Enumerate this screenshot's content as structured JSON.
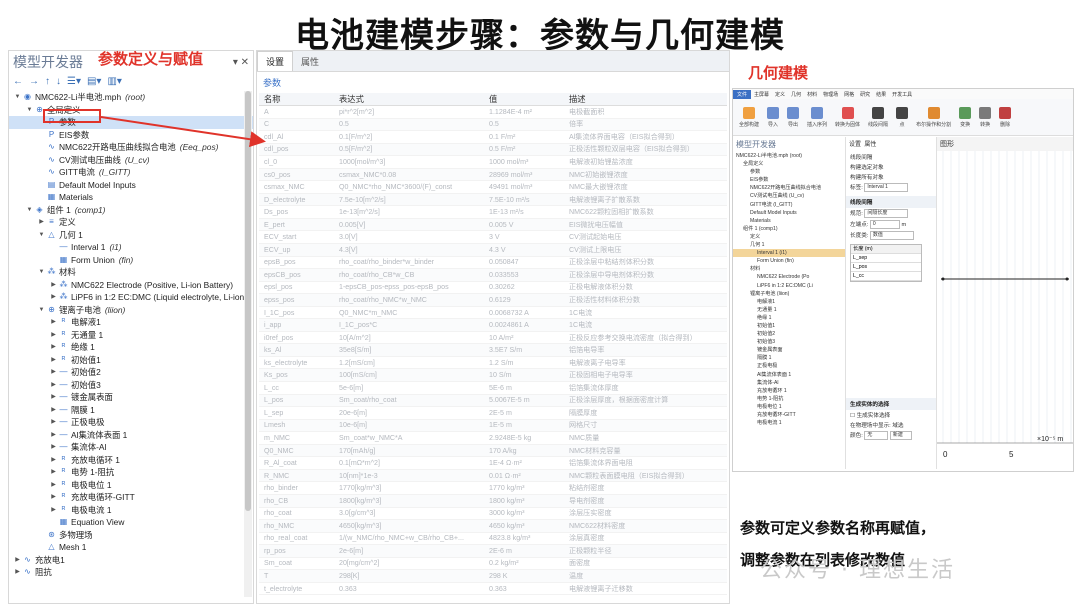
{
  "title": "电池建模步骤：参数与几何建模",
  "left_panel": {
    "header": "模型开发器",
    "annotation": "参数定义与赋值",
    "tree": [
      {
        "indent": 0,
        "tw": "▼",
        "icon": "◉",
        "text": "NMC622-Li半电池.mph",
        "tag": "(root)"
      },
      {
        "indent": 1,
        "tw": "▼",
        "icon": "⊕",
        "text": "全局定义",
        "tag": ""
      },
      {
        "indent": 2,
        "tw": "",
        "icon": "P",
        "text": "参数",
        "tag": "",
        "sel": true
      },
      {
        "indent": 2,
        "tw": "",
        "icon": "P",
        "text": "EIS参数",
        "tag": ""
      },
      {
        "indent": 2,
        "tw": "",
        "icon": "∿",
        "text": "NMC622开路电压曲线拟合电池",
        "tag": "(Eeq_pos)"
      },
      {
        "indent": 2,
        "tw": "",
        "icon": "∿",
        "text": "CV测试电压曲线",
        "tag": "(U_cv)"
      },
      {
        "indent": 2,
        "tw": "",
        "icon": "∿",
        "text": "GITT电流",
        "tag": "(I_GITT)"
      },
      {
        "indent": 2,
        "tw": "",
        "icon": "▤",
        "text": "Default Model Inputs",
        "tag": ""
      },
      {
        "indent": 2,
        "tw": "",
        "icon": "▦",
        "text": "Materials",
        "tag": ""
      },
      {
        "indent": 1,
        "tw": "▼",
        "icon": "◈",
        "text": "组件 1",
        "tag": "(comp1)"
      },
      {
        "indent": 2,
        "tw": "▶",
        "icon": "≡",
        "text": "定义",
        "tag": ""
      },
      {
        "indent": 2,
        "tw": "▼",
        "icon": "△",
        "text": "几何 1",
        "tag": ""
      },
      {
        "indent": 3,
        "tw": "",
        "icon": "—",
        "text": "Interval 1",
        "tag": "(i1)"
      },
      {
        "indent": 3,
        "tw": "",
        "icon": "▦",
        "text": "Form Union",
        "tag": "(fin)"
      },
      {
        "indent": 2,
        "tw": "▼",
        "icon": "⁂",
        "text": "材料",
        "tag": ""
      },
      {
        "indent": 3,
        "tw": "▶",
        "icon": "⁂",
        "text": "NMC622 Electrode  (Positive, Li-ion Battery)",
        "tag": ""
      },
      {
        "indent": 3,
        "tw": "▶",
        "icon": "⁂",
        "text": "LiPF6 in 1:2 EC:DMC (Liquid electrolyte, Li-ion",
        "tag": ""
      },
      {
        "indent": 2,
        "tw": "▼",
        "icon": "⊕",
        "text": "锂离子电池",
        "tag": "(liion)"
      },
      {
        "indent": 3,
        "tw": "▶",
        "icon": "ᴿ",
        "text": "电解液1",
        "tag": ""
      },
      {
        "indent": 3,
        "tw": "▶",
        "icon": "ᴿ",
        "text": "无通量 1",
        "tag": ""
      },
      {
        "indent": 3,
        "tw": "▶",
        "icon": "ᴿ",
        "text": "绝缘 1",
        "tag": ""
      },
      {
        "indent": 3,
        "tw": "▶",
        "icon": "ᴿ",
        "text": "初始值1",
        "tag": ""
      },
      {
        "indent": 3,
        "tw": "▶",
        "icon": "—",
        "text": "初始值2",
        "tag": ""
      },
      {
        "indent": 3,
        "tw": "▶",
        "icon": "—",
        "text": "初始值3",
        "tag": ""
      },
      {
        "indent": 3,
        "tw": "▶",
        "icon": "—",
        "text": "镀金属表面",
        "tag": ""
      },
      {
        "indent": 3,
        "tw": "▶",
        "icon": "—",
        "text": "隔膜 1",
        "tag": ""
      },
      {
        "indent": 3,
        "tw": "▶",
        "icon": "—",
        "text": "正极电极",
        "tag": ""
      },
      {
        "indent": 3,
        "tw": "▶",
        "icon": "—",
        "text": "Al集流体表面 1",
        "tag": ""
      },
      {
        "indent": 3,
        "tw": "▶",
        "icon": "—",
        "text": "集流体-Al",
        "tag": ""
      },
      {
        "indent": 3,
        "tw": "▶",
        "icon": "ᴿ",
        "text": "充放电循环 1",
        "tag": ""
      },
      {
        "indent": 3,
        "tw": "▶",
        "icon": "ᴿ",
        "text": "电势 1-阻抗",
        "tag": ""
      },
      {
        "indent": 3,
        "tw": "▶",
        "icon": "ᴿ",
        "text": "电极电位 1",
        "tag": ""
      },
      {
        "indent": 3,
        "tw": "▶",
        "icon": "ᴿ",
        "text": "充放电循环-GITT",
        "tag": ""
      },
      {
        "indent": 3,
        "tw": "▶",
        "icon": "ᴿ",
        "text": "电极电流 1",
        "tag": ""
      },
      {
        "indent": 3,
        "tw": "",
        "icon": "▦",
        "text": "Equation View",
        "tag": ""
      },
      {
        "indent": 2,
        "tw": "",
        "icon": "⊛",
        "text": "多物理场",
        "tag": ""
      },
      {
        "indent": 2,
        "tw": "",
        "icon": "△",
        "text": "Mesh 1",
        "tag": ""
      },
      {
        "indent": 0,
        "tw": "▶",
        "icon": "∿",
        "text": "充放电1",
        "tag": ""
      },
      {
        "indent": 0,
        "tw": "▶",
        "icon": "∿",
        "text": "阻抗",
        "tag": ""
      }
    ]
  },
  "mid_panel": {
    "tabs": [
      "设置",
      "属性"
    ],
    "section": "参数",
    "columns": [
      "名称",
      "表达式",
      "值",
      "描述"
    ],
    "rows": [
      [
        "A",
        "pi*r^2[m^2]",
        "1.1284E-4 m²",
        "电极截面积"
      ],
      [
        "C",
        "0.5",
        "0.5",
        "倍率"
      ],
      [
        "cdl_Al",
        "0.1[F/m^2]",
        "0.1 F/m²",
        "Al集流体界面电容（EIS拟合得到）"
      ],
      [
        "cdl_pos",
        "0.5[F/m^2]",
        "0.5 F/m²",
        "正极活性颗粒双层电容（EIS拟合得到）"
      ],
      [
        "cl_0",
        "1000[mol/m^3]",
        "1000 mol/m³",
        "电解液初始锂盐浓度"
      ],
      [
        "cs0_pos",
        "csmax_NMC*0.08",
        "28969 mol/m³",
        "NMC初始嵌锂浓度"
      ],
      [
        "csmax_NMC",
        "Q0_NMC*rho_NMC*3600/(F)_const",
        "49491 mol/m³",
        "NMC最大嵌锂浓度"
      ],
      [
        "D_electrolyte",
        "7.5e-10[m^2/s]",
        "7.5E-10 m²/s",
        "电解液锂离子扩散系数"
      ],
      [
        "Ds_pos",
        "1e-13[m^2/s]",
        "1E-13 m²/s",
        "NMC622颗粒固相扩散系数"
      ],
      [
        "E_pert",
        "0.005[V]",
        "0.005 V",
        "EIS微扰电压幅值"
      ],
      [
        "ECV_start",
        "3.0[V]",
        "3 V",
        "CV测试起始电压"
      ],
      [
        "ECV_up",
        "4.3[V]",
        "4.3 V",
        "CV测试上限电压"
      ],
      [
        "epsB_pos",
        "rho_coat/rho_binder*w_binder",
        "0.050847",
        "正极涂层中粘结剂体积分数"
      ],
      [
        "epsCB_pos",
        "rho_coat/rho_CB*w_CB",
        "0.033553",
        "正极涂层中导电剂体积分数"
      ],
      [
        "epsl_pos",
        "1-epsCB_pos-epss_pos-epsB_pos",
        "0.30262",
        "正极电解液体积分数"
      ],
      [
        "epss_pos",
        "rho_coat/rho_NMC*w_NMC",
        "0.6129",
        "正极活性材料体积分数"
      ],
      [
        "I_1C_pos",
        "Q0_NMC*m_NMC",
        "0.0068732 A",
        "1C电流"
      ],
      [
        "i_app",
        "I_1C_pos*C",
        "0.0024861 A",
        "1C电流"
      ],
      [
        "i0ref_pos",
        "10[A/m^2]",
        "10 A/m²",
        "正极反应参考交换电流密度（拟合得到）"
      ],
      [
        "ks_Al",
        "35e8[S/m]",
        "3.5E7 S/m",
        "铝箔电导率"
      ],
      [
        "ks_electrolyte",
        "1.2[mS/cm]",
        "1.2 S/m",
        "电解液离子电导率"
      ],
      [
        "Ks_pos",
        "100[mS/cm]",
        "10 S/m",
        "正极固相电子电导率"
      ],
      [
        "L_cc",
        "5e-6[m]",
        "5E-6 m",
        "铝箔集流体厚度"
      ],
      [
        "L_pos",
        "Sm_coat/rho_coat",
        "5.0067E-5 m",
        "正极涂层厚度，根据面密度计算"
      ],
      [
        "L_sep",
        "20e-6[m]",
        "2E-5 m",
        "隔膜厚度"
      ],
      [
        "Lmesh",
        "10e-6[m]",
        "1E-5 m",
        "网格尺寸"
      ],
      [
        "m_NMC",
        "Sm_coat*w_NMC*A",
        "2.9248E-5 kg",
        "NMC质量"
      ],
      [
        "Q0_NMC",
        "170[mAh/g]",
        "170 A/kg",
        "NMC材料克容量"
      ],
      [
        "R_Al_coat",
        "0.1[mΩ*m^2]",
        "1E-4 Ω·m²",
        "铝箔集流体界面电阻"
      ],
      [
        "R_NMC",
        "10[nm]*1e-3",
        "0.01 Ω·m²",
        "NMC颗粒表面膜电阻（EIS拟合得到）"
      ],
      [
        "rho_binder",
        "1770[kg/m^3]",
        "1770 kg/m³",
        "粘结剂密度"
      ],
      [
        "rho_CB",
        "1800[kg/m^3]",
        "1800 kg/m³",
        "导电剂密度"
      ],
      [
        "rho_coat",
        "3.0[g/cm^3]",
        "3000 kg/m³",
        "涂层压实密度"
      ],
      [
        "rho_NMC",
        "4650[kg/m^3]",
        "4650 kg/m³",
        "NMC622材料密度"
      ],
      [
        "rho_real_coat",
        "1/(w_NMC/rho_NMC+w_CB/rho_CB+...",
        "4823.8 kg/m³",
        "涂层真密度"
      ],
      [
        "rp_pos",
        "2e-6[m]",
        "2E-6 m",
        "正极颗粒半径"
      ],
      [
        "Sm_coat",
        "20[mg/cm^2]",
        "0.2 kg/m²",
        "面密度"
      ],
      [
        "T",
        "298[K]",
        "298 K",
        "温度"
      ],
      [
        "t_electrolyte",
        "0.363",
        "0.363",
        "电解液锂离子迁移数"
      ]
    ]
  },
  "right_panel": {
    "annotation": "几何建模",
    "menu": [
      "文件",
      "主屏幕",
      "定义",
      "几何",
      "材料",
      "物理场",
      "网格",
      "研究",
      "结果",
      "开发工具"
    ],
    "ribbon": [
      "全部构建",
      "导入",
      "导出",
      "插入序列",
      "转换为固体",
      "线段间隔",
      "点",
      "布尔操作和分割",
      "变换",
      "转换",
      "删除"
    ],
    "tree_title": "模型开发器",
    "tree": [
      {
        "indent": 0,
        "text": "NMC622-Li半电池.mph (root)"
      },
      {
        "indent": 1,
        "text": "全局定义"
      },
      {
        "indent": 2,
        "text": "参数"
      },
      {
        "indent": 2,
        "text": "EIS参数"
      },
      {
        "indent": 2,
        "text": "NMC622开路电压曲线拟合电池"
      },
      {
        "indent": 2,
        "text": "CV测试电压曲线 (U_cv)"
      },
      {
        "indent": 2,
        "text": "GITT电流 (I_GITT)"
      },
      {
        "indent": 2,
        "text": "Default Model Inputs"
      },
      {
        "indent": 2,
        "text": "Materials"
      },
      {
        "indent": 1,
        "text": "组件 1 (comp1)"
      },
      {
        "indent": 2,
        "text": "定义"
      },
      {
        "indent": 2,
        "text": "几何 1"
      },
      {
        "indent": 3,
        "text": "Interval 1 (i1)",
        "sel": true
      },
      {
        "indent": 3,
        "text": "Form Union (fin)"
      },
      {
        "indent": 2,
        "text": "材料"
      },
      {
        "indent": 3,
        "text": "NMC622 Electrode (Po"
      },
      {
        "indent": 3,
        "text": "LiPF6 in 1:2 EC:DMC (Li"
      },
      {
        "indent": 2,
        "text": "锂离子电池 (liion)"
      },
      {
        "indent": 3,
        "text": "电解液1"
      },
      {
        "indent": 3,
        "text": "无通量 1"
      },
      {
        "indent": 3,
        "text": "绝缘 1"
      },
      {
        "indent": 3,
        "text": "初始值1"
      },
      {
        "indent": 3,
        "text": "初始值2"
      },
      {
        "indent": 3,
        "text": "初始值3"
      },
      {
        "indent": 3,
        "text": "镀金属表面"
      },
      {
        "indent": 3,
        "text": "隔膜 1"
      },
      {
        "indent": 3,
        "text": "正极电极"
      },
      {
        "indent": 3,
        "text": "Al集流体表面 1"
      },
      {
        "indent": 3,
        "text": "集流体-Al"
      },
      {
        "indent": 3,
        "text": "充放电循环 1"
      },
      {
        "indent": 3,
        "text": "电势 1-阻抗"
      },
      {
        "indent": 3,
        "text": "电极电位 1"
      },
      {
        "indent": 3,
        "text": "充放电循环-GITT"
      },
      {
        "indent": 3,
        "text": "电极电流 1"
      }
    ],
    "settings": {
      "tabs": [
        "设置",
        "属性"
      ],
      "title": "线段间隔",
      "build_selected": "构建选定对象",
      "build_all": "构建所有对象",
      "label_key": "标签:",
      "label_value": "Interval 1",
      "section": "线段间隔",
      "spec_key": "规范:",
      "spec_value": "间隔长度",
      "left_key": "左端点:",
      "left_value": "0",
      "left_unit": "m",
      "length_key": "长度类:",
      "length_value": "数值",
      "table_header": "长度 (m)",
      "table_rows": [
        "L_sep",
        "L_pos",
        "L_cc"
      ],
      "section2": "生成实体的选择",
      "checkbox": "生成实体选择",
      "show_label": "在物理场中显示:",
      "show_value": "域选",
      "color_label": "颜色:",
      "color_value": "无",
      "new_button": "新建"
    },
    "graph": {
      "title": "图形",
      "ticks": [
        "0",
        "5"
      ],
      "unit": "×10⁻⁵ m"
    }
  },
  "caption_lines": [
    "参数可定义参数名称再赋值，",
    "调整参数在列表修改数值"
  ],
  "watermark": "公众号 · 理想生活"
}
